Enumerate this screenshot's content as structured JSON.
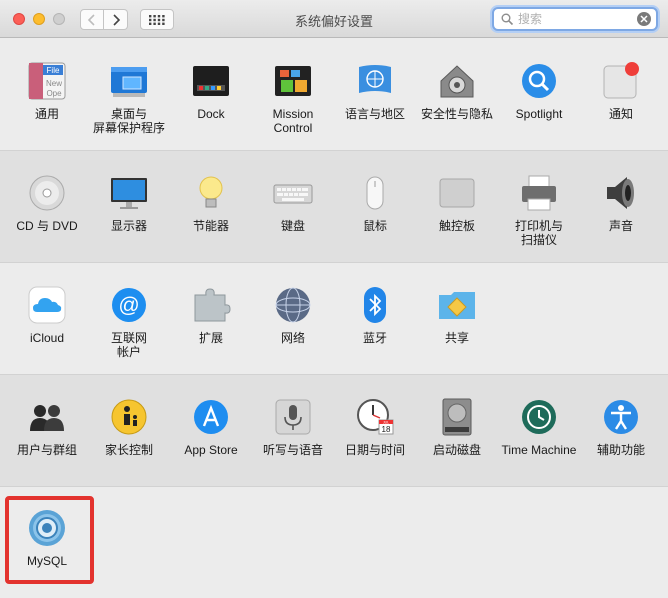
{
  "window": {
    "title": "系统偏好设置"
  },
  "search": {
    "placeholder": "搜索"
  },
  "rows": [
    [
      "通用",
      "桌面与\n屏幕保护程序",
      "Dock",
      "Mission\nControl",
      "语言与地区",
      "安全性与隐私",
      "Spotlight",
      "通知"
    ],
    [
      "CD 与 DVD",
      "显示器",
      "节能器",
      "键盘",
      "鼠标",
      "触控板",
      "打印机与\n扫描仪",
      "声音"
    ],
    [
      "iCloud",
      "互联网\n帐户",
      "扩展",
      "网络",
      "蓝牙",
      "共享"
    ],
    [
      "用户与群组",
      "家长控制",
      "App Store",
      "听写与语音",
      "日期与时间",
      "启动磁盘",
      "Time Machine",
      "辅助功能"
    ],
    [
      "MySQL"
    ]
  ],
  "icons": {
    "general": {
      "text": [
        "File",
        "New",
        "Ope"
      ]
    },
    "datetime": {
      "month": "JUL",
      "day": "18"
    }
  },
  "colors": {
    "highlight": "#e3332e",
    "search_focus": "#7ea8e4"
  }
}
